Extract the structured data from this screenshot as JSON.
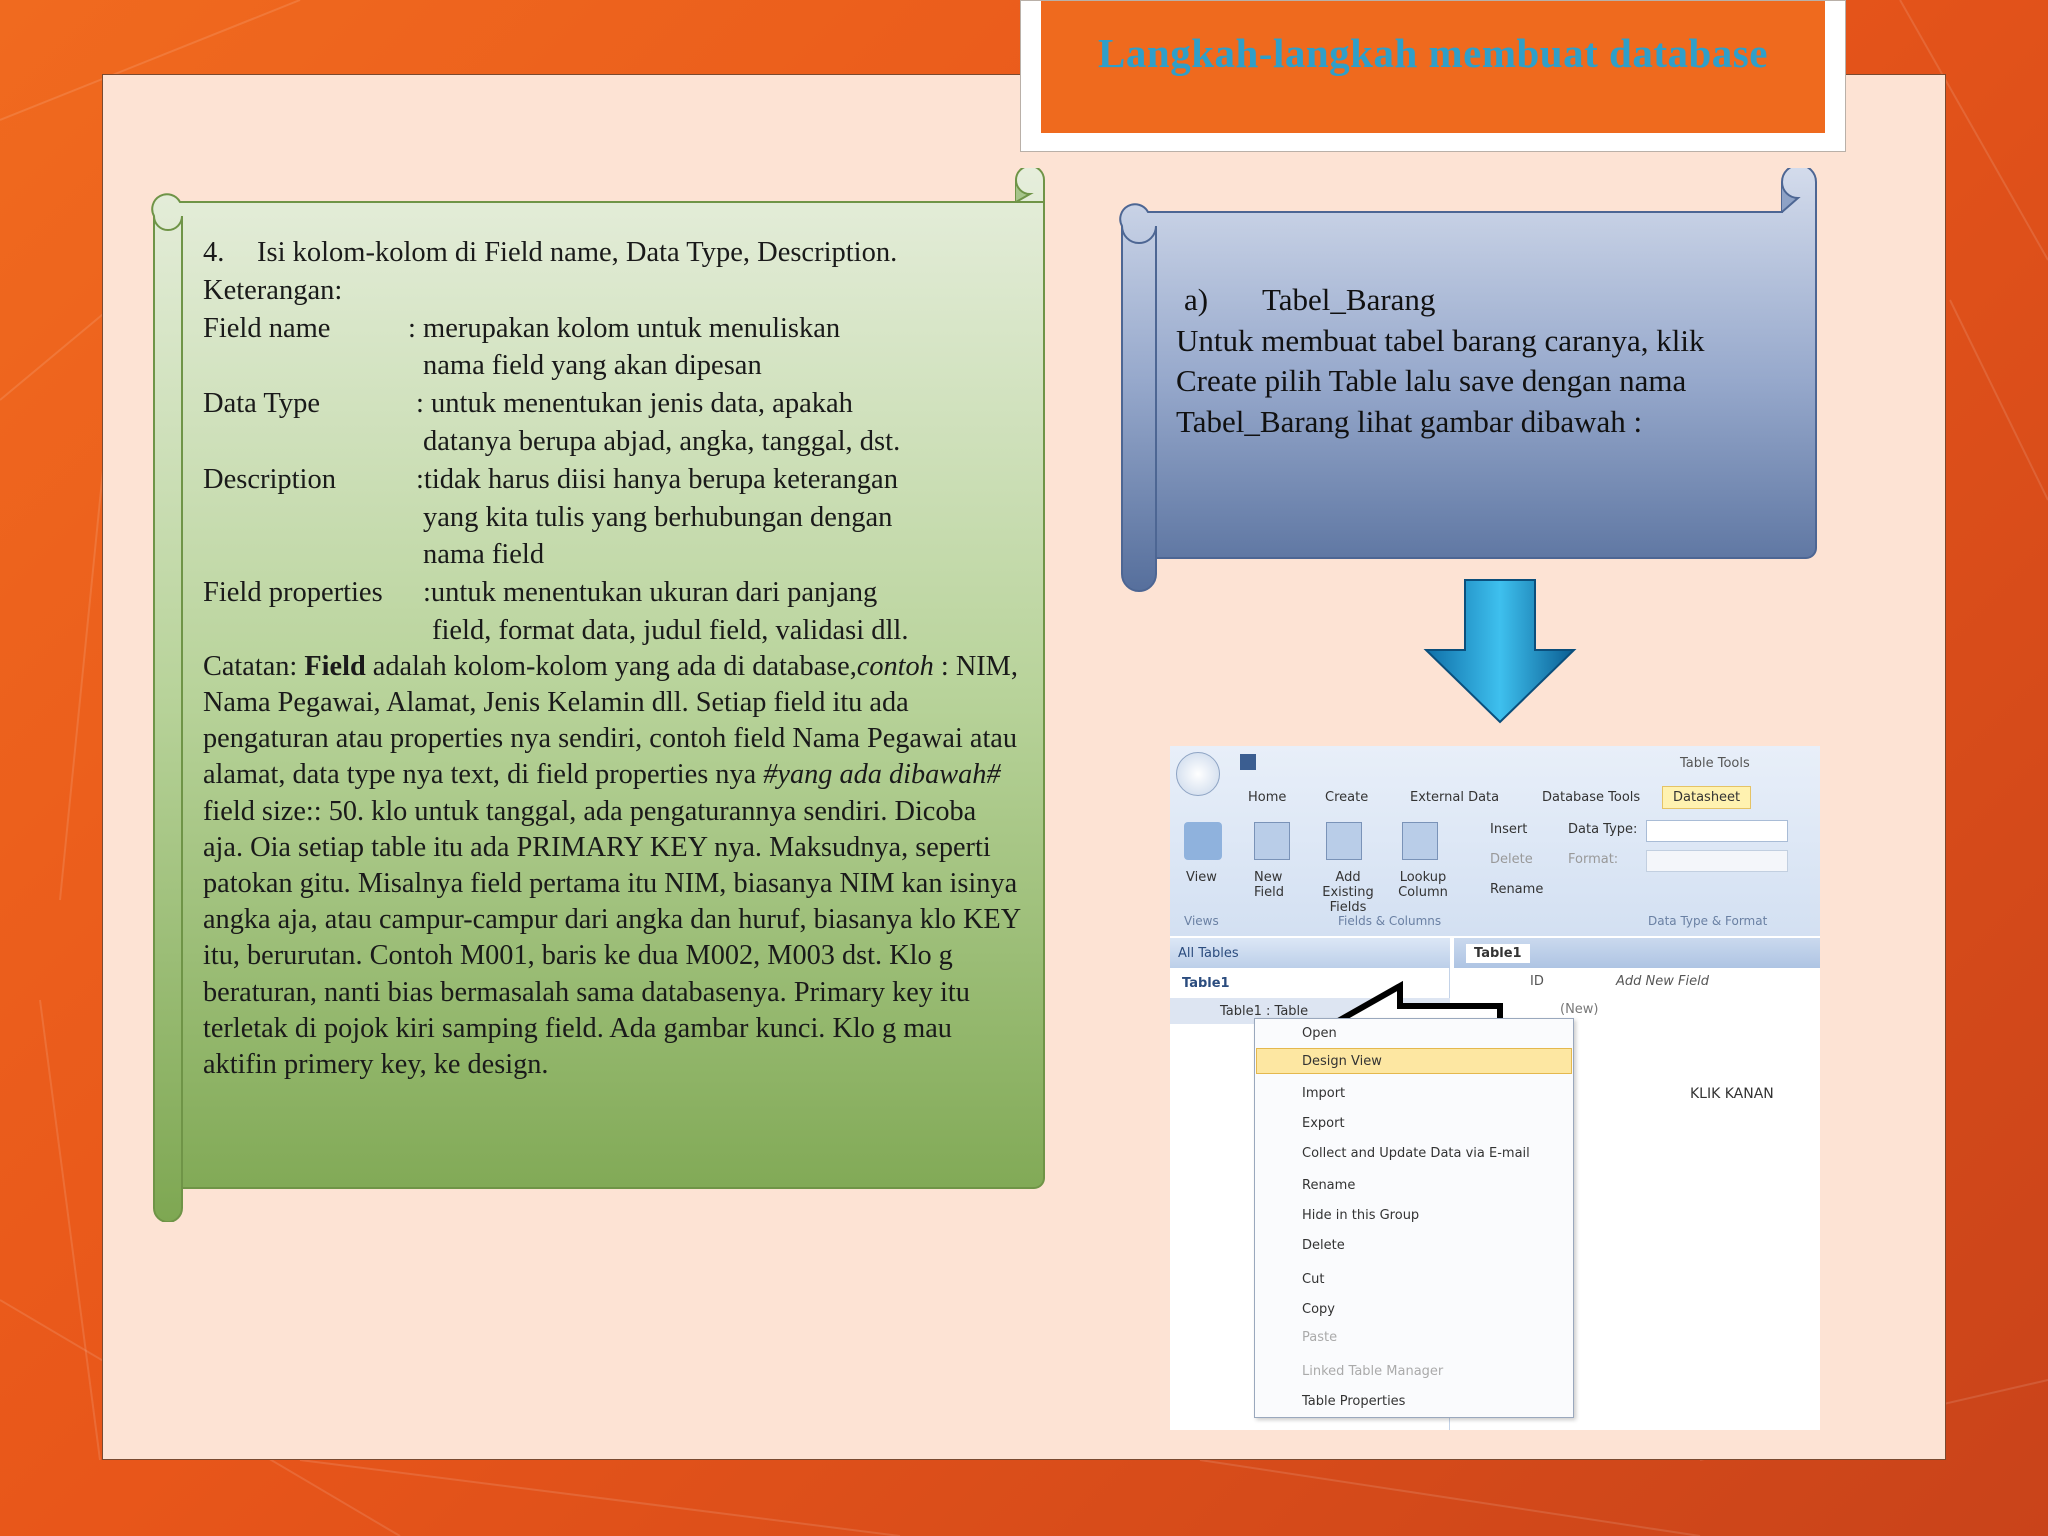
{
  "slide": {
    "title": "Langkah-langkah membuat database"
  },
  "left_panel": {
    "heading_num": "4.",
    "heading": "Isi kolom-kolom di Field name, Data Type, Description.",
    "keterangan": "Keterangan:",
    "fields": [
      {
        "label": "Field name",
        "line1": ": merupakan kolom untuk menuliskan",
        "line2": "nama field yang akan dipesan"
      },
      {
        "label": "Data Type",
        "line1": ": untuk menentukan jenis data, apakah",
        "line2": "datanya berupa abjad, angka, tanggal, dst."
      },
      {
        "label": "Description",
        "line1": ":tidak harus diisi hanya berupa keterangan",
        "line2": "yang kita tulis yang berhubungan dengan",
        "line3": "nama field"
      },
      {
        "label": "Field properties",
        "line1": ":untuk menentukan ukuran dari panjang",
        "line2": "field, format data, judul field, validasi dll."
      }
    ],
    "catatan_prefix": "Catatan: ",
    "catatan_bold": "Field",
    "catatan_1": " adalah kolom-kolom yang ada di database,",
    "catatan_italic1": "contoh",
    "catatan_2": " : NIM, Nama Pegawai, Alamat, Jenis Kelamin dll. Setiap field itu ada pengaturan atau properties nya sendiri, contoh field Nama Pegawai atau alamat, data type nya text, di field properties nya ",
    "catatan_italic2": "#yang ada dibawah#",
    "catatan_3": " field size:: 50. klo untuk tanggal, ada pengaturannya sendiri. Dicoba aja. Oia setiap table itu ada PRIMARY KEY nya. Maksudnya, seperti patokan gitu. Misalnya field pertama itu NIM, biasanya NIM kan isinya angka aja, atau campur-campur dari angka dan huruf, biasanya klo KEY itu, berurutan. Contoh M001, baris ke dua M002, M003 dst. Klo g beraturan, nanti bias bermasalah sama databasenya. Primary key itu terletak di pojok kiri samping field. Ada gambar kunci. Klo g mau aktifin primery key, ke design."
  },
  "right_panel": {
    "item_num": "a)",
    "item_title": "Tabel_Barang",
    "lines": [
      "Untuk membuat tabel barang caranya, klik",
      "Create pilih Table lalu save dengan nama",
      "Tabel_Barang lihat gambar dibawah :"
    ]
  },
  "screenshot": {
    "table_tools": "Table Tools",
    "tabs": [
      "Home",
      "Create",
      "External Data",
      "Database Tools",
      "Datasheet"
    ],
    "ribbon": {
      "view": "View",
      "new_field": "New Field",
      "add_existing": "Add Existing Fields",
      "lookup": "Lookup Column",
      "insert": "Insert",
      "delete": "Delete",
      "rename": "Rename",
      "data_type": "Data Type:",
      "format": "Format:",
      "group_views": "Views",
      "group_fields": "Fields & Columns",
      "group_datatype": "Data Type & Format"
    },
    "nav_header": "All Tables",
    "nav_group": "Table1",
    "nav_item": "Table1 : Table",
    "doc_tab": "Table1",
    "col_id": "ID",
    "col_add": "Add New Field",
    "new_row": "(New)",
    "menu": [
      "Open",
      "Design View",
      "Import",
      "Export",
      "Collect and Update Data via E-mail",
      "Rename",
      "Hide in this Group",
      "Delete",
      "Cut",
      "Copy",
      "Paste",
      "Linked Table Manager",
      "Table Properties"
    ],
    "note": "KLIK KANAN"
  }
}
